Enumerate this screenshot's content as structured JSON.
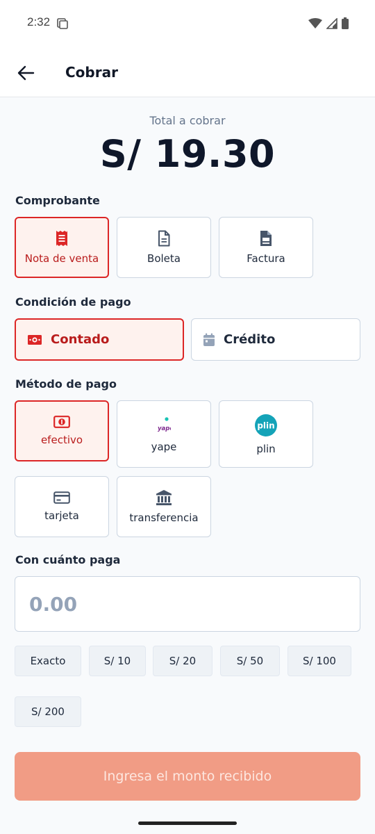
{
  "status_bar": {
    "time": "2:32"
  },
  "header": {
    "title": "Cobrar"
  },
  "total": {
    "label": "Total a cobrar",
    "amount": "S/ 19.30"
  },
  "comprobante": {
    "label": "Comprobante",
    "options": [
      "Nota de venta",
      "Boleta",
      "Factura"
    ],
    "selected": "Nota de venta"
  },
  "condicion": {
    "label": "Condición de pago",
    "options": [
      "Contado",
      "Crédito"
    ],
    "selected": "Contado"
  },
  "metodo": {
    "label": "Método de pago",
    "options": [
      "efectivo",
      "yape",
      "plin",
      "tarjeta",
      "transferencia"
    ],
    "selected": "efectivo",
    "yape_logo_text": "yape",
    "plin_logo_text": "plin"
  },
  "pago": {
    "label": "Con cuánto paga",
    "placeholder": "0.00",
    "quick_amounts": [
      "Exacto",
      "S/ 10",
      "S/ 20",
      "S/ 50",
      "S/ 100",
      "S/ 200"
    ]
  },
  "submit": {
    "label": "Ingresa el monto recibido"
  },
  "colors": {
    "accent": "#DC2626",
    "selected_bg": "#FEF2EE",
    "submit_disabled": "#F19C85",
    "plin": "#14A3B8",
    "yape": "#7E2A8E"
  }
}
